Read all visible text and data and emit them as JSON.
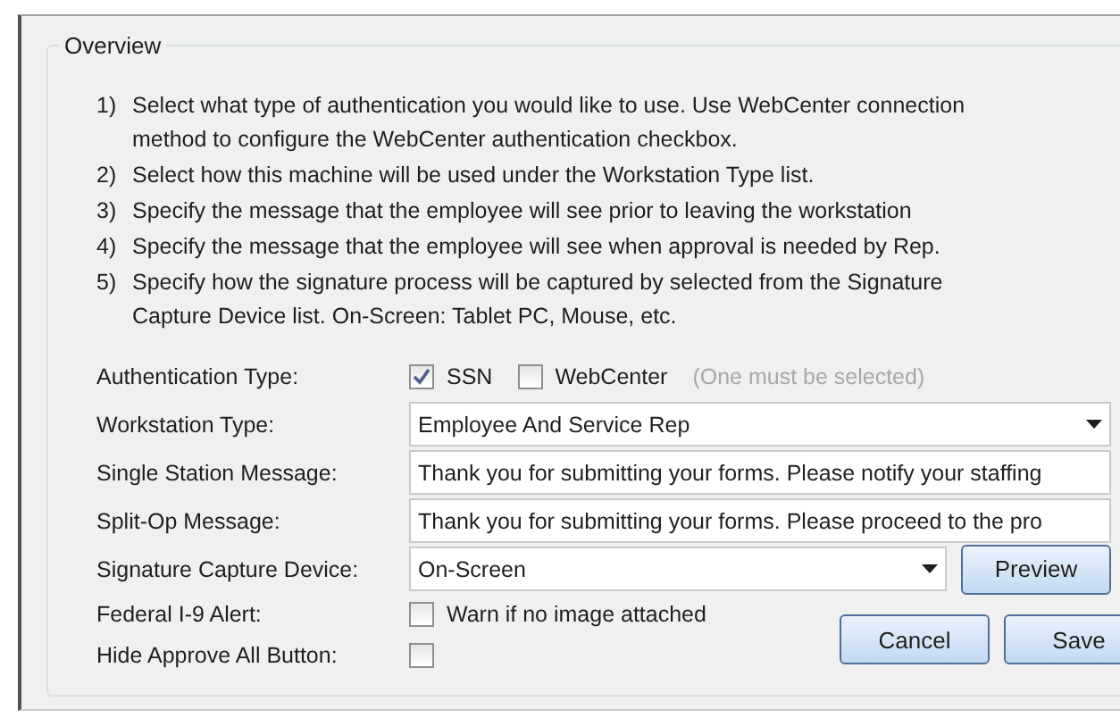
{
  "group_title": "Overview",
  "instructions": [
    {
      "number": "1)",
      "lines": [
        "Select what type of authentication you would like to use. Use WebCenter connection",
        "method to configure the WebCenter authentication checkbox."
      ]
    },
    {
      "number": "2)",
      "lines": [
        "Select how this machine will be used under the Workstation Type list."
      ]
    },
    {
      "number": "3)",
      "lines": [
        "Specify the message that the employee will see prior to leaving the workstation"
      ]
    },
    {
      "number": "4)",
      "lines": [
        "Specify the message that the employee will see when approval is needed by Rep."
      ]
    },
    {
      "number": "5)",
      "lines": [
        "Specify how the signature process will be captured by selected from the Signature",
        "Capture Device list. On-Screen: Tablet PC, Mouse, etc."
      ]
    }
  ],
  "authentication": {
    "label": "Authentication Type:",
    "options": [
      {
        "label": "SSN",
        "checked": true
      },
      {
        "label": "WebCenter",
        "checked": false
      }
    ],
    "hint": "(One must be selected)"
  },
  "workstation_type": {
    "label": "Workstation Type:",
    "value": "Employee And Service Rep"
  },
  "single_station_message": {
    "label": "Single Station Message:",
    "value": "Thank you for submitting your forms. Please notify your staffing"
  },
  "split_op_message": {
    "label": "Split-Op Message:",
    "value": "Thank you for submitting your forms. Please proceed to the pro"
  },
  "signature_device": {
    "label": "Signature Capture Device:",
    "value": "On-Screen",
    "button": "Preview"
  },
  "federal_alert": {
    "label": "Federal I-9 Alert:",
    "option": "Warn if no image attached",
    "checked": false
  },
  "hide_approve": {
    "label": "Hide Approve All Button:",
    "checked": false
  },
  "buttons": [
    "Cancel",
    "Save"
  ]
}
